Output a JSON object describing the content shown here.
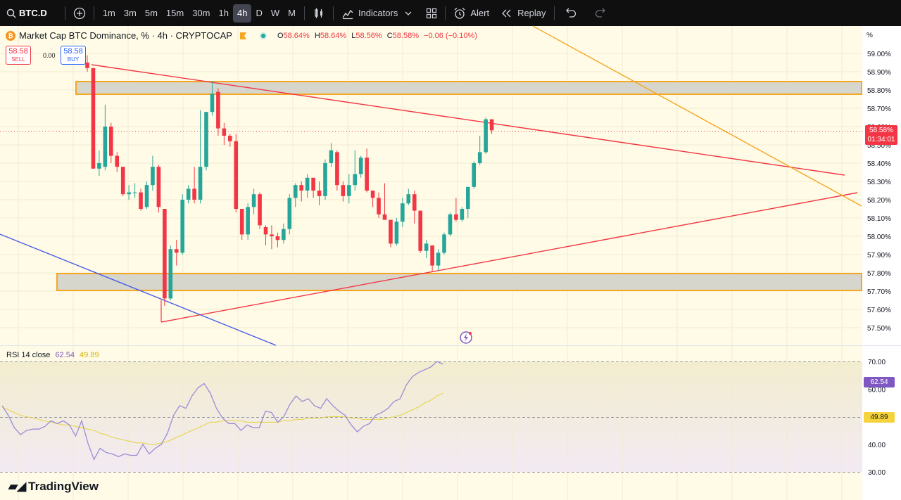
{
  "toolbar": {
    "symbol": "BTC.D",
    "timeframes": [
      "1m",
      "3m",
      "5m",
      "15m",
      "30m",
      "1h",
      "4h",
      "D",
      "W",
      "M"
    ],
    "active_timeframe": "4h",
    "indicators_label": "Indicators",
    "alert_label": "Alert",
    "replay_label": "Replay"
  },
  "legend": {
    "title": "Market Cap BTC Dominance, % · 4h · CRYPTOCAP",
    "open_label": "O",
    "open": "58.64%",
    "high_label": "H",
    "high": "58.64%",
    "low_label": "L",
    "low": "58.56%",
    "close_label": "C",
    "close": "58.58%",
    "change": "−0.06 (−0.10%)"
  },
  "trade": {
    "sell_price": "58.58",
    "sell_label": "SELL",
    "spread": "0.00",
    "buy_price": "58.58",
    "buy_label": "BUY"
  },
  "price_axis": {
    "unit": "%",
    "ticks": [
      "59.00%",
      "58.90%",
      "58.80%",
      "58.70%",
      "58.60%",
      "58.50%",
      "58.40%",
      "58.30%",
      "58.20%",
      "58.10%",
      "58.00%",
      "57.90%",
      "57.80%",
      "57.70%",
      "57.60%",
      "57.50%"
    ],
    "current_price": "58.58%",
    "countdown": "01:34:01"
  },
  "rsi": {
    "label": "RSI 14 close",
    "value": "62.54",
    "ma_value": "49.89",
    "ticks": [
      "70.00",
      "60.00",
      "40.00",
      "30.00"
    ]
  },
  "colors": {
    "up": "#26a69a",
    "down": "#f23645",
    "rsi_line": "#7e57c2",
    "rsi_ma": "#e8d44d",
    "trendline": "#f23645",
    "channel": "#f5a623",
    "blue_line": "#4a5ee8",
    "chart_bg": "#fffbe6"
  },
  "brand": "TradingView",
  "chart_data": {
    "type": "candlestick",
    "title": "Market Cap BTC Dominance, % · 4h · CRYPTOCAP",
    "ylim": [
      57.45,
      59.05
    ],
    "candles": [
      {
        "o": 58.95,
        "h": 58.99,
        "l": 58.9,
        "c": 58.92
      },
      {
        "o": 58.92,
        "h": 58.92,
        "l": 58.37,
        "c": 58.37
      },
      {
        "o": 58.37,
        "h": 58.47,
        "l": 58.33,
        "c": 58.4
      },
      {
        "o": 58.38,
        "h": 58.72,
        "l": 58.36,
        "c": 58.6
      },
      {
        "o": 58.6,
        "h": 58.62,
        "l": 58.4,
        "c": 58.44
      },
      {
        "o": 58.44,
        "h": 58.46,
        "l": 58.35,
        "c": 58.38
      },
      {
        "o": 58.38,
        "h": 58.38,
        "l": 58.22,
        "c": 58.23
      },
      {
        "o": 58.23,
        "h": 58.28,
        "l": 58.2,
        "c": 58.24
      },
      {
        "o": 58.24,
        "h": 58.29,
        "l": 58.21,
        "c": 58.24
      },
      {
        "o": 58.24,
        "h": 58.26,
        "l": 58.14,
        "c": 58.15
      },
      {
        "o": 58.16,
        "h": 58.3,
        "l": 58.15,
        "c": 58.28
      },
      {
        "o": 58.28,
        "h": 58.44,
        "l": 58.25,
        "c": 58.38
      },
      {
        "o": 58.38,
        "h": 58.39,
        "l": 58.13,
        "c": 58.16
      },
      {
        "o": 58.15,
        "h": 58.15,
        "l": 57.62,
        "c": 57.66
      },
      {
        "o": 57.66,
        "h": 57.95,
        "l": 57.65,
        "c": 57.93
      },
      {
        "o": 57.93,
        "h": 57.98,
        "l": 57.84,
        "c": 57.91
      },
      {
        "o": 57.91,
        "h": 58.23,
        "l": 57.9,
        "c": 58.2
      },
      {
        "o": 58.2,
        "h": 58.28,
        "l": 58.18,
        "c": 58.26
      },
      {
        "o": 58.26,
        "h": 58.38,
        "l": 58.18,
        "c": 58.2
      },
      {
        "o": 58.2,
        "h": 58.69,
        "l": 58.18,
        "c": 58.38
      },
      {
        "o": 58.38,
        "h": 58.68,
        "l": 58.36,
        "c": 58.68
      },
      {
        "o": 58.68,
        "h": 58.85,
        "l": 58.66,
        "c": 58.78
      },
      {
        "o": 58.79,
        "h": 58.81,
        "l": 58.55,
        "c": 58.59
      },
      {
        "o": 58.59,
        "h": 58.62,
        "l": 58.5,
        "c": 58.55
      },
      {
        "o": 58.55,
        "h": 58.56,
        "l": 58.49,
        "c": 58.52
      },
      {
        "o": 58.52,
        "h": 58.56,
        "l": 58.13,
        "c": 58.15
      },
      {
        "o": 58.15,
        "h": 58.15,
        "l": 57.98,
        "c": 58.01
      },
      {
        "o": 58.01,
        "h": 58.18,
        "l": 57.98,
        "c": 58.16
      },
      {
        "o": 58.16,
        "h": 58.26,
        "l": 58.12,
        "c": 58.23
      },
      {
        "o": 58.23,
        "h": 58.24,
        "l": 58.04,
        "c": 58.06
      },
      {
        "o": 58.05,
        "h": 58.06,
        "l": 57.95,
        "c": 58.01
      },
      {
        "o": 58.01,
        "h": 58.06,
        "l": 57.93,
        "c": 58.0
      },
      {
        "o": 58.0,
        "h": 58.02,
        "l": 57.94,
        "c": 57.98
      },
      {
        "o": 57.98,
        "h": 58.07,
        "l": 57.96,
        "c": 58.04
      },
      {
        "o": 58.04,
        "h": 58.23,
        "l": 58.01,
        "c": 58.21
      },
      {
        "o": 58.21,
        "h": 58.29,
        "l": 58.16,
        "c": 58.28
      },
      {
        "o": 58.28,
        "h": 58.3,
        "l": 58.19,
        "c": 58.25
      },
      {
        "o": 58.25,
        "h": 58.34,
        "l": 58.21,
        "c": 58.32
      },
      {
        "o": 58.32,
        "h": 58.32,
        "l": 58.21,
        "c": 58.25
      },
      {
        "o": 58.25,
        "h": 58.3,
        "l": 58.17,
        "c": 58.22
      },
      {
        "o": 58.22,
        "h": 58.42,
        "l": 58.2,
        "c": 58.4
      },
      {
        "o": 58.4,
        "h": 58.51,
        "l": 58.38,
        "c": 58.47
      },
      {
        "o": 58.46,
        "h": 58.47,
        "l": 58.25,
        "c": 58.28
      },
      {
        "o": 58.28,
        "h": 58.3,
        "l": 58.19,
        "c": 58.22
      },
      {
        "o": 58.22,
        "h": 58.34,
        "l": 58.18,
        "c": 58.28
      },
      {
        "o": 58.28,
        "h": 58.47,
        "l": 58.25,
        "c": 58.34
      },
      {
        "o": 58.34,
        "h": 58.44,
        "l": 58.32,
        "c": 58.43
      },
      {
        "o": 58.43,
        "h": 58.48,
        "l": 58.24,
        "c": 58.25
      },
      {
        "o": 58.25,
        "h": 58.25,
        "l": 58.16,
        "c": 58.21
      },
      {
        "o": 58.21,
        "h": 58.24,
        "l": 58.1,
        "c": 58.12
      },
      {
        "o": 58.12,
        "h": 58.29,
        "l": 58.1,
        "c": 58.09
      },
      {
        "o": 58.09,
        "h": 58.09,
        "l": 57.94,
        "c": 57.96
      },
      {
        "o": 57.96,
        "h": 58.1,
        "l": 57.95,
        "c": 58.08
      },
      {
        "o": 58.08,
        "h": 58.21,
        "l": 58.05,
        "c": 58.18
      },
      {
        "o": 58.18,
        "h": 58.26,
        "l": 58.17,
        "c": 58.23
      },
      {
        "o": 58.23,
        "h": 58.25,
        "l": 58.07,
        "c": 58.14
      },
      {
        "o": 58.14,
        "h": 58.14,
        "l": 57.91,
        "c": 57.92
      },
      {
        "o": 57.92,
        "h": 57.98,
        "l": 57.88,
        "c": 57.96
      },
      {
        "o": 57.95,
        "h": 57.95,
        "l": 57.81,
        "c": 57.84
      },
      {
        "o": 57.84,
        "h": 57.93,
        "l": 57.81,
        "c": 57.91
      },
      {
        "o": 57.91,
        "h": 58.02,
        "l": 57.9,
        "c": 58.01
      },
      {
        "o": 58.01,
        "h": 58.13,
        "l": 58.0,
        "c": 58.12
      },
      {
        "o": 58.12,
        "h": 58.21,
        "l": 58.08,
        "c": 58.09
      },
      {
        "o": 58.09,
        "h": 58.16,
        "l": 58.08,
        "c": 58.15
      },
      {
        "o": 58.15,
        "h": 58.27,
        "l": 58.1,
        "c": 58.27
      },
      {
        "o": 58.27,
        "h": 58.41,
        "l": 58.26,
        "c": 58.4
      },
      {
        "o": 58.4,
        "h": 58.55,
        "l": 58.39,
        "c": 58.46
      },
      {
        "o": 58.46,
        "h": 58.65,
        "l": 58.45,
        "c": 58.64
      },
      {
        "o": 58.64,
        "h": 58.64,
        "l": 58.56,
        "c": 58.58
      }
    ],
    "rsi_values": [
      58,
      51,
      42,
      37,
      40,
      41,
      41,
      43,
      47,
      45,
      47,
      44,
      36,
      47,
      31,
      19,
      27,
      24,
      23,
      21,
      23,
      22,
      22,
      30,
      23,
      27,
      30,
      38,
      51,
      58,
      56,
      65,
      71,
      74,
      67,
      56,
      49,
      45,
      45,
      40,
      44,
      42,
      42,
      54,
      53,
      46,
      50,
      59,
      65,
      61,
      63,
      58,
      56,
      63,
      58,
      54,
      51,
      44,
      39,
      43,
      45,
      51,
      53,
      56,
      61,
      63,
      73,
      79,
      82,
      84,
      86,
      90,
      88
    ],
    "rsi_ma_values": [
      57,
      55,
      53,
      51,
      50,
      49,
      48,
      47,
      46,
      45,
      44,
      44,
      43,
      42,
      41,
      40,
      38,
      37,
      35,
      34,
      33,
      32,
      31,
      31,
      30,
      30,
      31,
      32,
      34,
      36,
      38,
      40,
      42,
      44,
      46,
      46,
      47,
      47,
      47,
      47,
      46,
      46,
      46,
      46,
      46,
      46,
      47,
      47,
      48,
      48,
      49,
      49,
      49,
      50,
      50,
      50,
      50,
      49,
      49,
      48,
      48,
      48,
      48,
      49,
      50,
      51,
      53,
      55,
      57,
      60,
      62,
      65,
      67
    ],
    "rsi_ylim": [
      25,
      75
    ]
  }
}
